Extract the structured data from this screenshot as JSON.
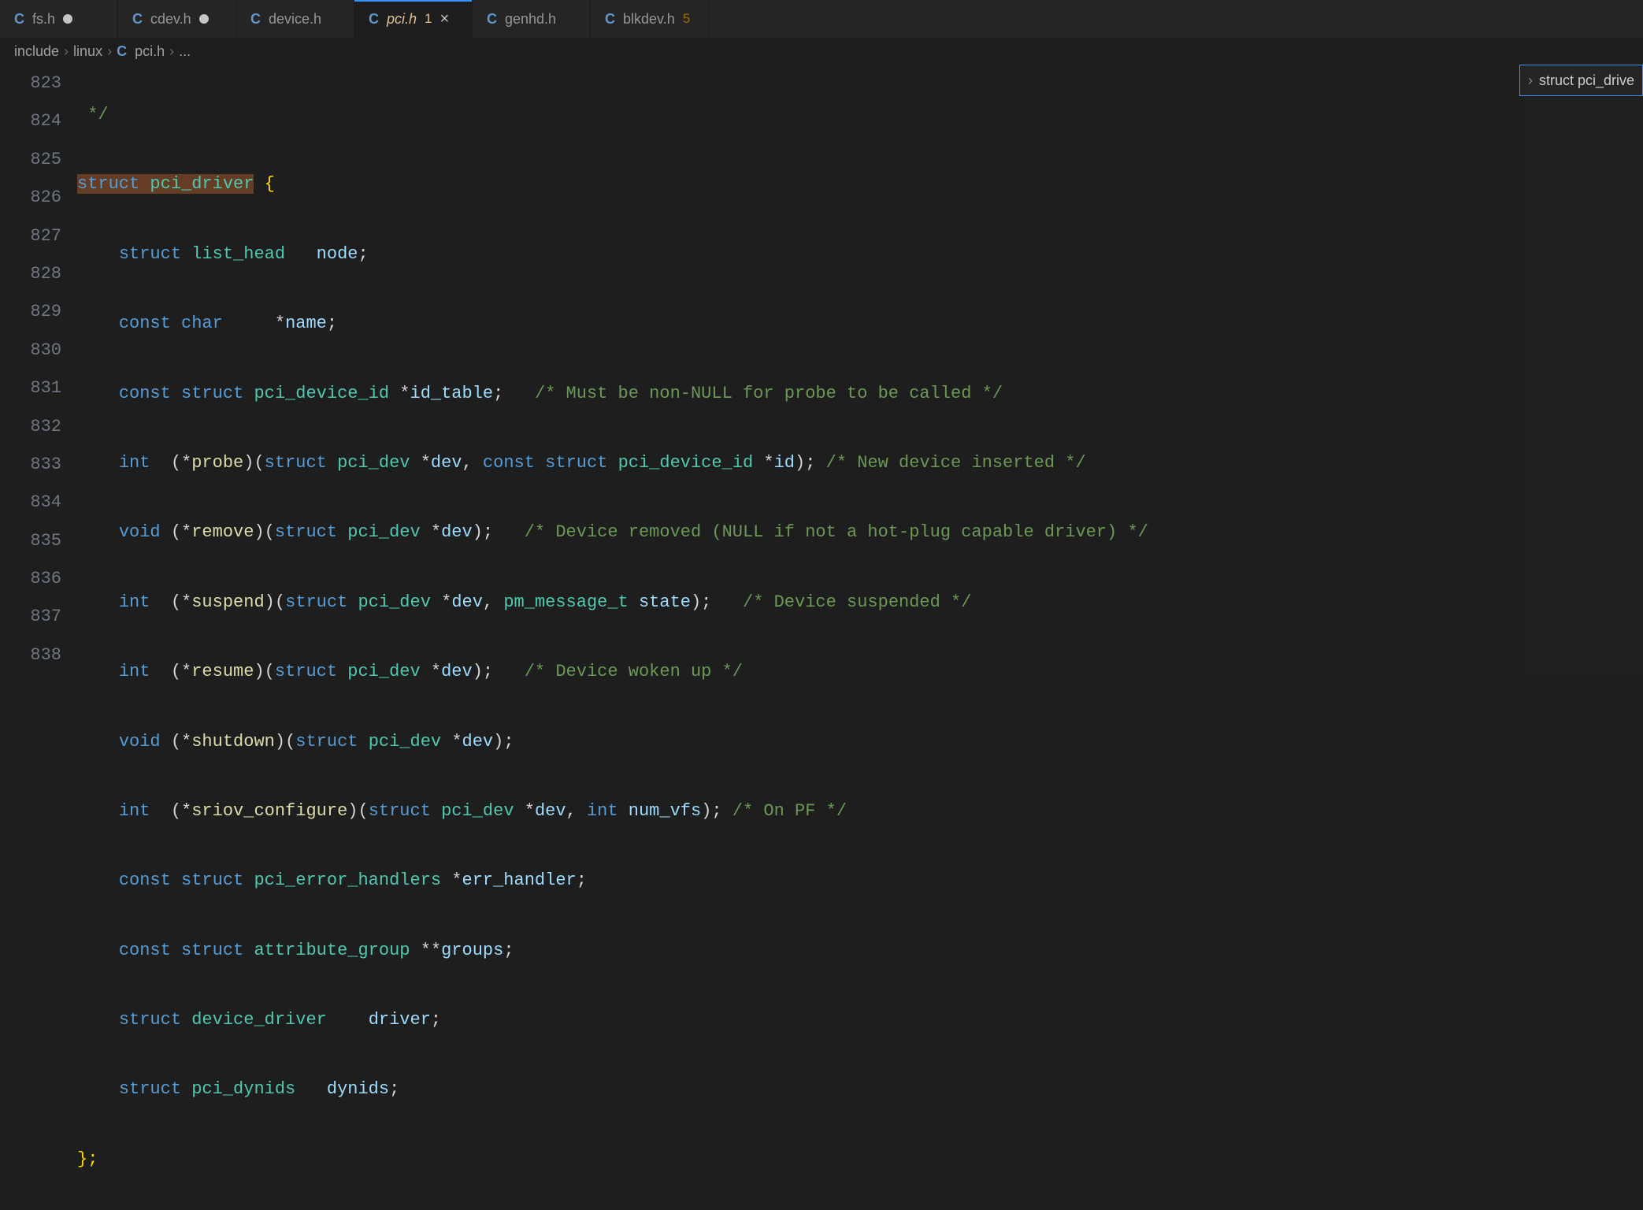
{
  "tabs": [
    {
      "label": "fs.h",
      "dirty": true,
      "active": false,
      "icon": "C",
      "badge": ""
    },
    {
      "label": "cdev.h",
      "dirty": true,
      "active": false,
      "icon": "C",
      "badge": ""
    },
    {
      "label": "device.h",
      "dirty": false,
      "active": false,
      "icon": "C",
      "badge": ""
    },
    {
      "label": "pci.h",
      "dirty": false,
      "active": true,
      "icon": "C",
      "badge": "1"
    },
    {
      "label": "genhd.h",
      "dirty": false,
      "active": false,
      "icon": "C",
      "badge": ""
    },
    {
      "label": "blkdev.h",
      "dirty": false,
      "active": false,
      "icon": "C",
      "badge": "5"
    }
  ],
  "breadcrumb": {
    "seg0": "include",
    "seg1": "linux",
    "icon": "C",
    "seg2": "pci.h",
    "seg3": "..."
  },
  "outline": {
    "label": "struct pci_drive"
  },
  "lines": {
    "n823": "823",
    "n824": "824",
    "n825": "825",
    "n826": "826",
    "n827": "827",
    "n828": "828",
    "n829": "829",
    "n830": "830",
    "n831": "831",
    "n832": "832",
    "n833": "833",
    "n834": "834",
    "n835": "835",
    "n836": "836",
    "n837": "837",
    "n838": "838"
  },
  "code": {
    "l823": {
      "cm": "*/"
    },
    "l824": {
      "kw": "struct",
      "ty": "pci_driver",
      "br": "{"
    },
    "l825": {
      "kw": "struct",
      "ty": "list_head",
      "id": "node",
      "sc": ";"
    },
    "l826": {
      "kw1": "const",
      "kw2": "char",
      "op": "*",
      "id": "name",
      "sc": ";"
    },
    "l827": {
      "kw1": "const",
      "kw2": "struct",
      "ty": "pci_device_id",
      "op": "*",
      "id": "id_table",
      "sc": ";",
      "cm": "/* Must be non-NULL for probe to be called */"
    },
    "l828": {
      "kw": "int",
      "op1": "(*",
      "fn": "probe",
      "op2": ")(",
      "kw2": "struct",
      "ty1": "pci_dev",
      "op3": "*",
      "id1": "dev",
      "c1": ", ",
      "kw3": "const",
      "kw4": "struct",
      "ty2": "pci_device_id",
      "op4": "*",
      "id2": "id",
      "op5": ");",
      "cm": "/* New device inserted */"
    },
    "l829": {
      "kw": "void",
      "op1": "(*",
      "fn": "remove",
      "op2": ")(",
      "kw2": "struct",
      "ty": "pci_dev",
      "op3": "*",
      "id": "dev",
      "op4": ");",
      "cm": "/* Device removed (NULL if not a hot-plug capable driver) */"
    },
    "l830": {
      "kw": "int",
      "op1": "(*",
      "fn": "suspend",
      "op2": ")(",
      "kw2": "struct",
      "ty": "pci_dev",
      "op3": "*",
      "id1": "dev",
      "c1": ", ",
      "ty2": "pm_message_t",
      "id2": "state",
      "op4": ");",
      "cm": "/* Device suspended */"
    },
    "l831": {
      "kw": "int",
      "op1": "(*",
      "fn": "resume",
      "op2": ")(",
      "kw2": "struct",
      "ty": "pci_dev",
      "op3": "*",
      "id": "dev",
      "op4": ");",
      "cm": "/* Device woken up */"
    },
    "l832": {
      "kw": "void",
      "op1": "(*",
      "fn": "shutdown",
      "op2": ")(",
      "kw2": "struct",
      "ty": "pci_dev",
      "op3": "*",
      "id": "dev",
      "op4": ");"
    },
    "l833": {
      "kw": "int",
      "op1": "(*",
      "fn": "sriov_configure",
      "op2": ")(",
      "kw2": "struct",
      "ty": "pci_dev",
      "op3": "*",
      "id1": "dev",
      "c1": ", ",
      "kw3": "int",
      "id2": "num_vfs",
      "op4": ");",
      "cm": "/* On PF */"
    },
    "l834": {
      "kw1": "const",
      "kw2": "struct",
      "ty": "pci_error_handlers",
      "op": "*",
      "id": "err_handler",
      "sc": ";"
    },
    "l835": {
      "kw1": "const",
      "kw2": "struct",
      "ty": "attribute_group",
      "op": "**",
      "id": "groups",
      "sc": ";"
    },
    "l836": {
      "kw": "struct",
      "ty": "device_driver",
      "id": "driver",
      "sc": ";"
    },
    "l837": {
      "kw": "struct",
      "ty": "pci_dynids",
      "id": "dynids",
      "sc": ";"
    },
    "l838": {
      "br": "};"
    }
  }
}
